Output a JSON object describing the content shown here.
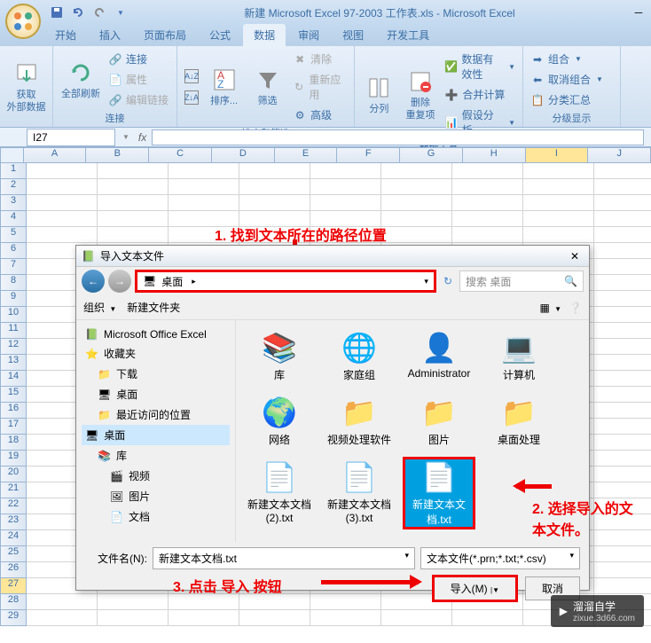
{
  "title": "新建 Microsoft Excel 97-2003 工作表.xls - Microsoft Excel",
  "tabs": [
    "开始",
    "插入",
    "页面布局",
    "公式",
    "数据",
    "审阅",
    "视图",
    "开发工具"
  ],
  "active_tab": 4,
  "ribbon": {
    "g1": {
      "btn1": "获取\n外部数据",
      "label": ""
    },
    "g2": {
      "refresh": "全部刷新",
      "conn": "连接",
      "prop": "属性",
      "editlink": "编辑链接",
      "label": "连接"
    },
    "g3": {
      "sort": "排序...",
      "filter": "筛选",
      "clear": "清除",
      "reapply": "重新应用",
      "adv": "高级",
      "label": "排序和筛选"
    },
    "g4": {
      "tocol": "分列",
      "dedup": "删除\n重复项",
      "valid": "数据有效性",
      "consol": "合并计算",
      "whatif": "假设分析",
      "label": "数据工具"
    },
    "g5": {
      "group": "组合",
      "ungroup": "取消组合",
      "subtotal": "分类汇总",
      "label": "分级显示"
    }
  },
  "name_box": "I27",
  "columns": [
    "A",
    "B",
    "C",
    "D",
    "E",
    "F",
    "G",
    "H",
    "I",
    "J"
  ],
  "highlight_col": "I",
  "rows": 29,
  "highlight_row": 27,
  "dialog": {
    "title": "导入文本文件",
    "path_label": "桌面",
    "search_placeholder": "搜索 桌面",
    "organize": "组织",
    "newfolder": "新建文件夹",
    "sidebar": [
      {
        "icon": "excel",
        "label": "Microsoft Office Excel",
        "indent": 0
      },
      {
        "icon": "star",
        "label": "收藏夹",
        "indent": 0
      },
      {
        "icon": "folder",
        "label": "下载",
        "indent": 1
      },
      {
        "icon": "desktop",
        "label": "桌面",
        "indent": 1
      },
      {
        "icon": "recent",
        "label": "最近访问的位置",
        "indent": 1
      },
      {
        "icon": "desktop",
        "label": "桌面",
        "indent": 0,
        "selected": true
      },
      {
        "icon": "lib",
        "label": "库",
        "indent": 1
      },
      {
        "icon": "video",
        "label": "视频",
        "indent": 2
      },
      {
        "icon": "pic",
        "label": "图片",
        "indent": 2
      },
      {
        "icon": "doc",
        "label": "文档",
        "indent": 2
      }
    ],
    "files": [
      {
        "icon": "lib",
        "label": "库"
      },
      {
        "icon": "homegroup",
        "label": "家庭组"
      },
      {
        "icon": "user",
        "label": "Administrator"
      },
      {
        "icon": "computer",
        "label": "计算机"
      },
      {
        "icon": "network",
        "label": "网络"
      },
      {
        "icon": "folder",
        "label": "视频处理软件"
      },
      {
        "icon": "folder",
        "label": "图片"
      },
      {
        "icon": "folder",
        "label": "桌面处理"
      },
      {
        "icon": "txt",
        "label": "新建文本文档 (2).txt"
      },
      {
        "icon": "txt",
        "label": "新建文本文档 (3).txt"
      },
      {
        "icon": "txt",
        "label": "新建文本文档.txt",
        "selected": true
      }
    ],
    "filename_label": "文件名(N):",
    "filename_value": "新建文本文档.txt",
    "filter_value": "文本文件(*.prn;*.txt;*.csv)",
    "import_btn": "导入(M)",
    "cancel_btn": "取消"
  },
  "annotations": {
    "a1": "1. 找到文本所在的路径位置",
    "a2": "2. 选择导入的文本文件。",
    "a3": "3. 点击 导入 按钮"
  },
  "watermark": {
    "main": "溜溜自学",
    "sub": "zixue.3d66.com"
  }
}
